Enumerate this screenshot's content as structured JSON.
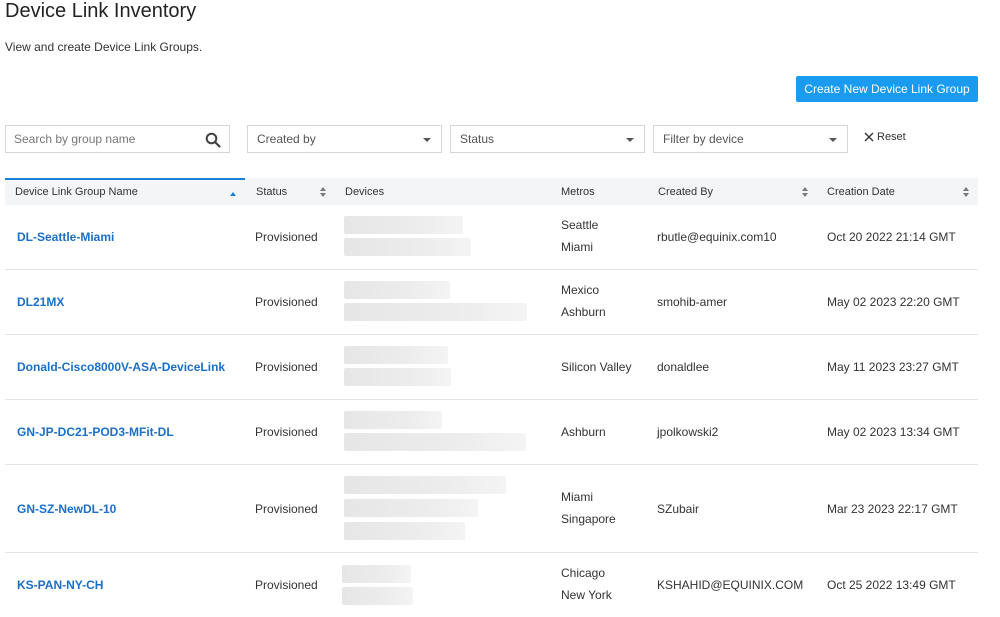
{
  "page": {
    "title": "Device Link Inventory",
    "subtitle": "View and create Device Link Groups.",
    "create_button": "Create New Device Link Group"
  },
  "filters": {
    "search_placeholder": "Search by group name",
    "created_by": "Created by",
    "status": "Status",
    "device": "Filter by device",
    "reset": "Reset"
  },
  "table": {
    "columns": [
      "Device Link Group Name",
      "Status",
      "Devices",
      "Metros",
      "Created By",
      "Creation Date"
    ],
    "rows": [
      {
        "name": "DL-Seattle-Miami",
        "status": "Provisioned",
        "metros": [
          "Seattle",
          "Miami"
        ],
        "created_by": "rbutle@equinix.com10",
        "date": "Oct 20 2022 21:14 GMT"
      },
      {
        "name": "DL21MX",
        "status": "Provisioned",
        "metros": [
          "Mexico",
          "Ashburn"
        ],
        "created_by": "smohib-amer",
        "date": "May 02 2023 22:20 GMT"
      },
      {
        "name": "Donald-Cisco8000V-ASA-DeviceLink",
        "status": "Provisioned",
        "metros": [
          "Silicon Valley"
        ],
        "created_by": "donaldlee",
        "date": "May 11 2023 23:27 GMT"
      },
      {
        "name": "GN-JP-DC21-POD3-MFit-DL",
        "status": "Provisioned",
        "metros": [
          "Ashburn"
        ],
        "created_by": "jpolkowski2",
        "date": "May 02 2023 13:34 GMT"
      },
      {
        "name": "GN-SZ-NewDL-10",
        "status": "Provisioned",
        "metros": [
          "Miami",
          "Singapore"
        ],
        "created_by": "SZubair",
        "date": "Mar 23 2023 22:17 GMT"
      },
      {
        "name": "KS-PAN-NY-CH",
        "status": "Provisioned",
        "metros": [
          "Chicago",
          "New York"
        ],
        "created_by": "KSHAHID@EQUINIX.COM",
        "date": "Oct 25 2022 13:49 GMT"
      }
    ]
  },
  "colors": {
    "accent": "#1a9bef",
    "link": "#1a6fc9"
  }
}
